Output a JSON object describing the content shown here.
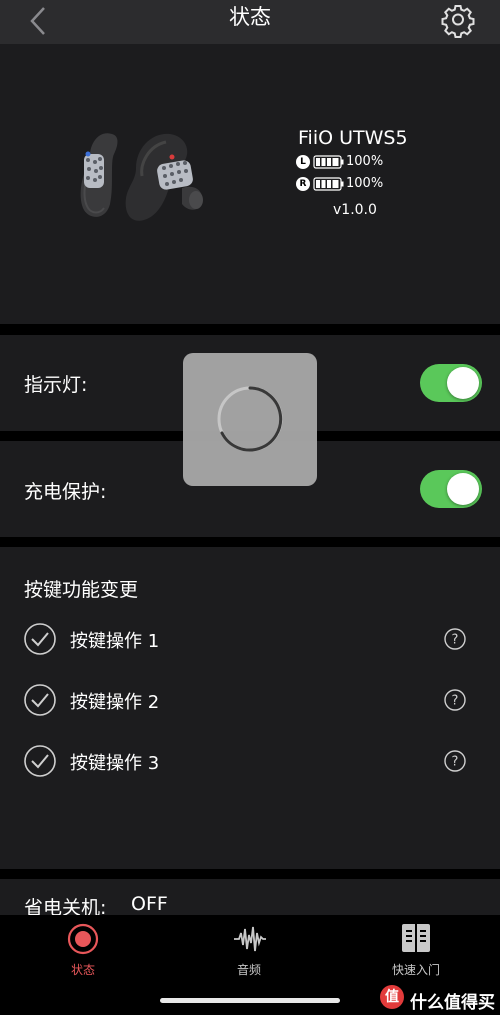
{
  "navbar": {
    "title": "状态",
    "back_icon": "chevron-left-icon",
    "settings_icon": "gear-icon"
  },
  "device": {
    "name": "FiiO UTWS5",
    "left": {
      "badge": "L",
      "battery": "100%",
      "battery_level": 1.0
    },
    "right": {
      "badge": "R",
      "battery": "100%",
      "battery_level": 1.0
    },
    "version": "v1.0.0"
  },
  "indicator": {
    "label": "指示灯:",
    "enabled": true
  },
  "charge_protect": {
    "label": "充电保护:",
    "enabled": true
  },
  "keys": {
    "title": "按键功能变更",
    "items": [
      {
        "label": "按键操作 1",
        "checked": true
      },
      {
        "label": "按键操作 2",
        "checked": true
      },
      {
        "label": "按键操作 3",
        "checked": true
      }
    ],
    "help_icon": "question-circle-icon"
  },
  "power_off": {
    "label": "省电关机:",
    "value": "OFF"
  },
  "tabs": [
    {
      "label": "状态",
      "icon": "record-icon",
      "active": true
    },
    {
      "label": "音频",
      "icon": "waveform-icon",
      "active": false
    },
    {
      "label": "快速入门",
      "icon": "book-icon",
      "active": false
    }
  ],
  "colors": {
    "accent": "#e8575a",
    "toggle_on": "#5ac85a",
    "section_bg": "#1c1c1e",
    "navbar_bg": "#2c2c2e"
  },
  "watermark": {
    "text": "什么值得买",
    "badge": "值"
  },
  "loading": {
    "icon": "spinner-icon"
  }
}
